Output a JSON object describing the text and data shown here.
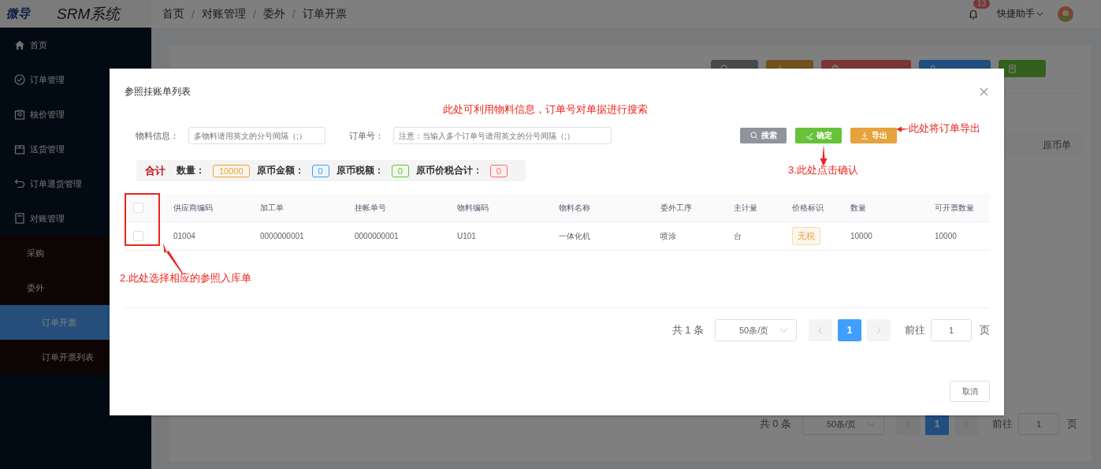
{
  "header": {
    "logo": "微导",
    "system_name": "SRM系统",
    "breadcrumb": [
      {
        "label": "首页",
        "separator": "/"
      },
      {
        "label": "对账管理",
        "separator": "/"
      },
      {
        "label": "委外",
        "separator": "/"
      },
      {
        "label": "订单开票"
      }
    ],
    "notification_count": "13",
    "user_menu": "快捷助手"
  },
  "sidebar": {
    "items": [
      {
        "label": "首页",
        "selected": false
      },
      {
        "label": "订单管理",
        "selected": false
      },
      {
        "label": "核价管理",
        "selected": false
      },
      {
        "label": "送货管理",
        "selected": false
      },
      {
        "label": "订单退货管理",
        "selected": false
      },
      {
        "label": "对账管理",
        "expanded": true,
        "children": [
          {
            "label": "采购",
            "selected": false
          },
          {
            "label": "委外",
            "expanded": true,
            "children": [
              {
                "label": "订单开票",
                "selected": true
              },
              {
                "label": "订单开票列表",
                "selected": false
              }
            ]
          }
        ]
      }
    ]
  },
  "page": {
    "buttons": [
      {
        "kind": "info"
      },
      {
        "kind": "warning"
      },
      {
        "kind": "danger"
      },
      {
        "kind": "primary"
      },
      {
        "kind": "success"
      }
    ],
    "table_columns": [
      "原币单"
    ],
    "pagination": {
      "total": "共 0 条",
      "page_size": "50条/页",
      "pages": [
        {
          "label": "1",
          "selected": true
        }
      ],
      "goto_label": "前往",
      "goto_value": "1",
      "page_suffix": "页"
    }
  },
  "modal": {
    "title": "参照挂账单列表",
    "filters": [
      {
        "label": "物料信息：",
        "placeholder": "多物料请用英文的分号间隔（;）"
      },
      {
        "label": "订单号：",
        "placeholder": "注意：当输入多个订单号请用英文的分号间隔（;）"
      }
    ],
    "buttons": [
      {
        "label": "搜索",
        "kind": "info"
      },
      {
        "label": "确定",
        "kind": "success"
      },
      {
        "label": "导出",
        "kind": "warning"
      }
    ],
    "summary": {
      "title": "合计",
      "items": [
        {
          "label": "数量：",
          "value": "10000",
          "color": "#e6a23c"
        },
        {
          "label": "原币金额：",
          "value": "0",
          "color": "#409eff"
        },
        {
          "label": "原币税额：",
          "value": "0",
          "color": "#67c23a"
        },
        {
          "label": "原币价税合计：",
          "value": "0",
          "color": "#f56c6c"
        }
      ]
    },
    "table": {
      "header_checked": false,
      "columns": [
        {
          "label": "供应商编码",
          "kind": "text"
        },
        {
          "label": "加工单",
          "kind": "text"
        },
        {
          "label": "挂帐单号",
          "kind": "text"
        },
        {
          "label": "物料编码",
          "kind": "text"
        },
        {
          "label": "物料名称",
          "kind": "text"
        },
        {
          "label": "委外工序",
          "kind": "text"
        },
        {
          "label": "主计量",
          "kind": "text"
        },
        {
          "label": "价格标识",
          "kind": "tag"
        },
        {
          "label": "数量",
          "kind": "text"
        },
        {
          "label": "可开票数量",
          "kind": "text"
        }
      ],
      "rows": [
        {
          "checked": false,
          "cells": [
            "01004",
            "0000000001",
            "0000000001",
            "U101",
            "一体化机",
            "喷涂",
            "台",
            "无税",
            "10000",
            "10000"
          ]
        }
      ]
    },
    "pagination": {
      "total": "共 1 条",
      "page_size": "50条/页",
      "pages": [
        {
          "label": "1",
          "selected": true
        }
      ],
      "goto_label": "前往",
      "goto_value": "1",
      "page_suffix": "页"
    },
    "cancel_button": "取消",
    "annotations": {
      "search_hint": "此处可利用物料信息，订单号对单据进行搜索",
      "export_hint": "此处将订单导出",
      "confirm_hint": "3.此处点击确认",
      "select_hint": "2.此处选择相应的参照入库单"
    }
  }
}
